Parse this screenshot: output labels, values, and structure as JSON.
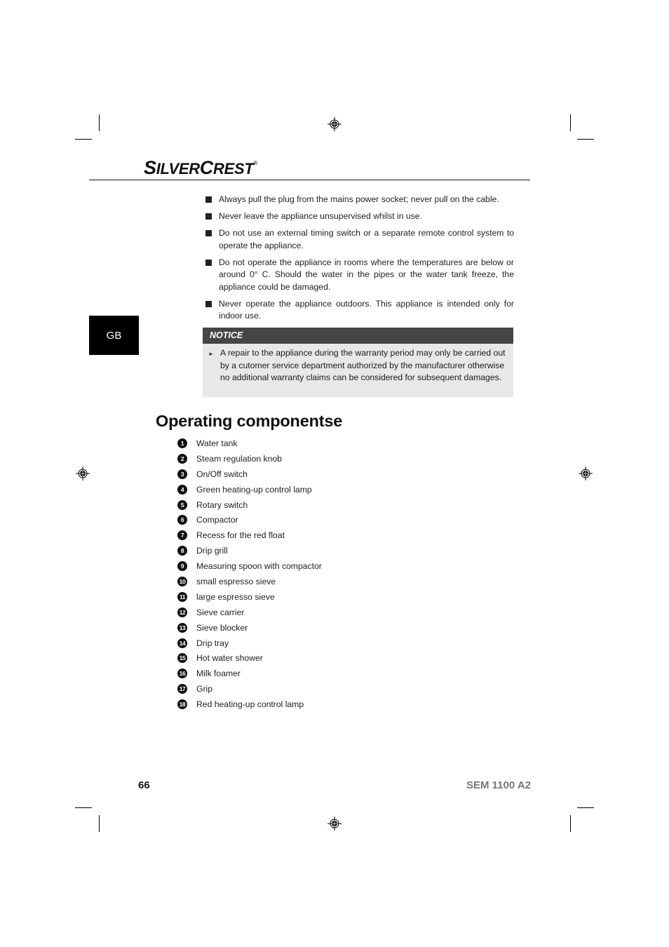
{
  "header": {
    "brand_prefix_big": "S",
    "brand_prefix_rest": "ILVER",
    "brand_suffix_big": "C",
    "brand_suffix_rest": "REST",
    "registered_mark": "®"
  },
  "language_tab": "GB",
  "safety_bullets": [
    "Always pull the plug from the mains power socket; never pull on the cable.",
    "Never leave the appliance unsupervised whilst in use.",
    "Do not use an external timing switch or a separate remote control system to operate the appliance.",
    "Do not operate the appliance in rooms where the temperatures are below or around 0° C. Should the water in the pipes or the water tank freeze, the appliance could be damaged.",
    "Never operate the appliance outdoors. This appliance is intended only for indoor use."
  ],
  "notice": {
    "title": "NOTICE",
    "text": "A repair to the appliance during the warranty period may only be carried out by a cutomer service department authorized by the manufacturer otherwise no additional warranty claims can be considered for subsequent damages."
  },
  "section_title": "Operating componentse",
  "components": [
    {
      "num": "1",
      "label": "Water tank"
    },
    {
      "num": "2",
      "label": "Steam regulation knob"
    },
    {
      "num": "3",
      "label": "On/Off switch"
    },
    {
      "num": "4",
      "label": "Green heating-up control lamp"
    },
    {
      "num": "5",
      "label": "Rotary switch"
    },
    {
      "num": "6",
      "label": "Compactor"
    },
    {
      "num": "7",
      "label": "Recess for the red float"
    },
    {
      "num": "8",
      "label": "Drip grill"
    },
    {
      "num": "9",
      "label": "Measuring spoon with compactor"
    },
    {
      "num": "10",
      "label": "small espresso sieve"
    },
    {
      "num": "11",
      "label": "large espresso sieve"
    },
    {
      "num": "12",
      "label": "Sieve carrier"
    },
    {
      "num": "13",
      "label": "Sieve blocker"
    },
    {
      "num": "14",
      "label": "Drip tray"
    },
    {
      "num": "15",
      "label": "Hot water shower"
    },
    {
      "num": "16",
      "label": "Milk foamer"
    },
    {
      "num": "17",
      "label": "Grip"
    },
    {
      "num": "18",
      "label": "Red heating-up control lamp"
    }
  ],
  "footer": {
    "page_number": "66",
    "model": "SEM 1100 A2"
  }
}
